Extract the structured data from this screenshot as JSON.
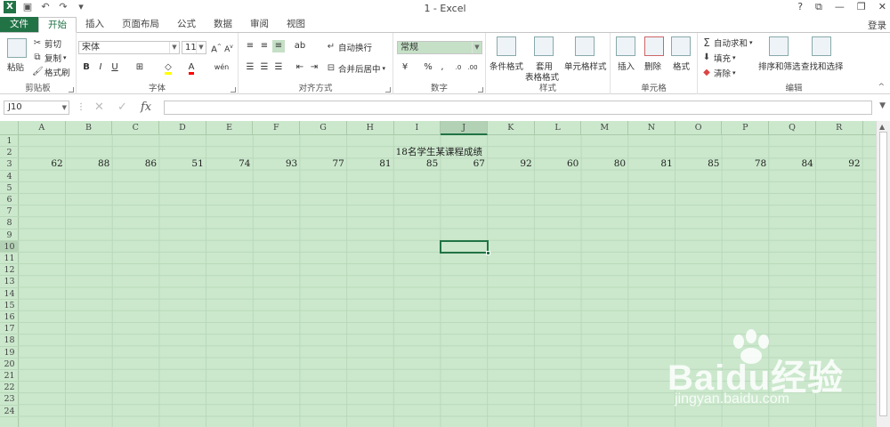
{
  "window": {
    "title": "1 - Excel"
  },
  "quick_access": {
    "save_icon": "save-icon",
    "undo_icon": "undo-icon",
    "redo_icon": "redo-icon"
  },
  "tabs": [
    {
      "label": "文件",
      "type": "file"
    },
    {
      "label": "开始",
      "type": "active"
    },
    {
      "label": "插入"
    },
    {
      "label": "页面布局"
    },
    {
      "label": "公式"
    },
    {
      "label": "数据"
    },
    {
      "label": "审阅"
    },
    {
      "label": "视图"
    }
  ],
  "account": {
    "login_label": "登录"
  },
  "ribbon": {
    "clipboard": {
      "group": "剪贴板",
      "paste": "粘贴",
      "cut": "剪切",
      "copy": "复制",
      "format_painter": "格式刷"
    },
    "font": {
      "group": "字体",
      "name": "宋体",
      "size": "11",
      "bold": "B",
      "italic": "I",
      "underline": "U",
      "grow": "A",
      "shrink": "A",
      "wen": "wén"
    },
    "alignment": {
      "group": "对齐方式",
      "wrap": "自动换行",
      "merge": "合并后居中"
    },
    "number": {
      "group": "数字",
      "format": "常规",
      "percent": "%",
      "comma": ","
    },
    "styles": {
      "group": "样式",
      "conditional": "条件格式",
      "table_line1": "套用",
      "table_line2": "表格格式",
      "cell_styles": "单元格样式"
    },
    "cells": {
      "group": "单元格",
      "insert": "插入",
      "delete": "删除",
      "format": "格式"
    },
    "editing": {
      "group": "编辑",
      "autosum": "自动求和",
      "fill": "填充",
      "clear": "清除",
      "sort": "排序和筛选",
      "find": "查找和选择"
    }
  },
  "formula_bar": {
    "name_box": "J10",
    "fx": "fx",
    "content": ""
  },
  "sheet": {
    "columns": [
      "A",
      "B",
      "C",
      "D",
      "E",
      "F",
      "G",
      "H",
      "I",
      "J",
      "K",
      "L",
      "M",
      "N",
      "O",
      "P",
      "Q",
      "R"
    ],
    "rows": [
      "1",
      "2",
      "3",
      "4",
      "5",
      "6",
      "7",
      "8",
      "9",
      "10",
      "11",
      "12",
      "13",
      "14",
      "15",
      "16",
      "17",
      "18",
      "19",
      "20",
      "21",
      "22",
      "23",
      "24"
    ],
    "selected_column": "J",
    "selected_row": "10",
    "title_cell": "18名学生某课程成绩",
    "scores": [
      62,
      88,
      86,
      51,
      74,
      93,
      77,
      81,
      85,
      67,
      92,
      60,
      80,
      81,
      85,
      78,
      84,
      92
    ]
  },
  "watermark": {
    "brand": "Baidu经验",
    "url": "jingyan.baidu.com"
  }
}
